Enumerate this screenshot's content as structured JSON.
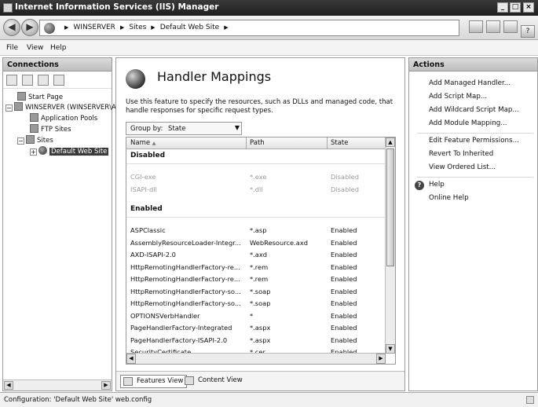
{
  "window": {
    "title": "Internet Information Services (IIS) Manager",
    "minimize_glyph": "_",
    "maximize_glyph": "□",
    "close_glyph": "×"
  },
  "addressbar": {
    "back_glyph": "◀",
    "forward_glyph": "▶",
    "crumbs": [
      "WINSERVER",
      "Sites",
      "Default Web Site"
    ],
    "separator": "▶",
    "tool_icons": [
      "connection-icon",
      "stop-icon",
      "home-icon",
      "help-icon"
    ]
  },
  "menu": [
    "File",
    "View",
    "Help"
  ],
  "connections": {
    "header": "Connections",
    "tree": [
      {
        "label": "Start Page",
        "icon": "start-page-icon"
      },
      {
        "label": "WINSERVER (WINSERVER\\Administrator)",
        "icon": "server-icon",
        "expander": "−"
      },
      {
        "label": "Application Pools",
        "icon": "app-pools-icon"
      },
      {
        "label": "FTP Sites",
        "icon": "ftp-sites-icon"
      },
      {
        "label": "Sites",
        "icon": "sites-folder-icon",
        "expander": "−"
      },
      {
        "label": "Default Web Site",
        "icon": "website-globe-icon",
        "expander": "+",
        "selected": true
      }
    ]
  },
  "feature": {
    "title": "Handler Mappings",
    "description": "Use this feature to specify the resources, such as DLLs and managed code, that handle responses for specific request types.",
    "group_by_label": "Group by:",
    "group_by_value": "State",
    "columns": [
      "Name",
      "Path",
      "State"
    ],
    "sort_glyph": "▲",
    "groups": [
      {
        "name": "Disabled",
        "rows": [
          {
            "name": "CGI-exe",
            "path": "*.exe",
            "state": "Disabled"
          },
          {
            "name": "ISAPI-dll",
            "path": "*.dll",
            "state": "Disabled"
          }
        ]
      },
      {
        "name": "Enabled",
        "rows": [
          {
            "name": "ASPClassic",
            "path": "*.asp",
            "state": "Enabled"
          },
          {
            "name": "AssemblyResourceLoader-Integr...",
            "path": "WebResource.axd",
            "state": "Enabled"
          },
          {
            "name": "AXD-ISAPI-2.0",
            "path": "*.axd",
            "state": "Enabled"
          },
          {
            "name": "HttpRemotingHandlerFactory-re...",
            "path": "*.rem",
            "state": "Enabled"
          },
          {
            "name": "HttpRemotingHandlerFactory-re...",
            "path": "*.rem",
            "state": "Enabled"
          },
          {
            "name": "HttpRemotingHandlerFactory-so...",
            "path": "*.soap",
            "state": "Enabled"
          },
          {
            "name": "HttpRemotingHandlerFactory-so...",
            "path": "*.soap",
            "state": "Enabled"
          },
          {
            "name": "OPTIONSVerbHandler",
            "path": "*",
            "state": "Enabled"
          },
          {
            "name": "PageHandlerFactory-Integrated",
            "path": "*.aspx",
            "state": "Enabled"
          },
          {
            "name": "PageHandlerFactory-ISAPI-2.0",
            "path": "*.aspx",
            "state": "Enabled"
          },
          {
            "name": "SecurityCertificate",
            "path": "*.cer",
            "state": "Enabled"
          }
        ]
      }
    ],
    "view_tabs": [
      "Features View",
      "Content View"
    ]
  },
  "actions": {
    "header": "Actions",
    "group1": [
      "Add Managed Handler...",
      "Add Script Map...",
      "Add Wildcard Script Map...",
      "Add Module Mapping..."
    ],
    "group2": [
      "Edit Feature Permissions...",
      "Revert To Inherited",
      "View Ordered List..."
    ],
    "help": "Help",
    "online_help": "Online Help"
  },
  "status": "Configuration: 'Default Web Site' web.config"
}
